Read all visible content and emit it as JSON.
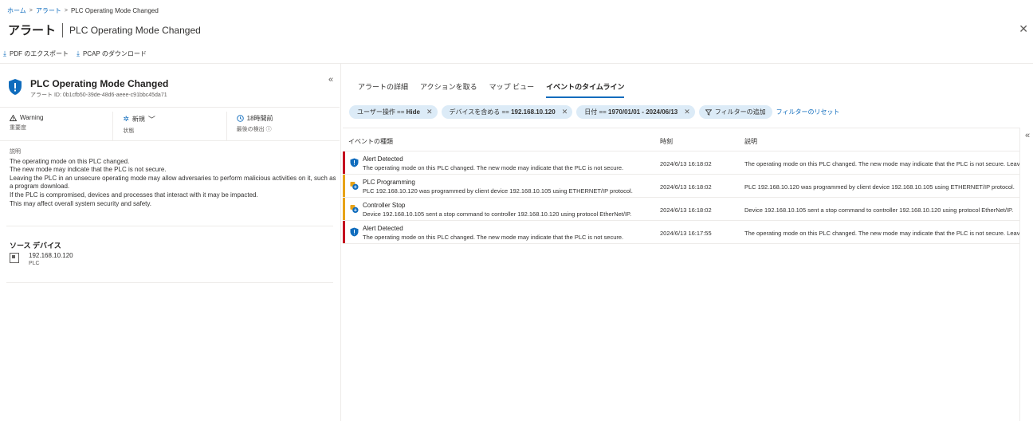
{
  "breadcrumb": {
    "home": "ホーム",
    "alerts": "アラート",
    "current": "PLC Operating Mode Changed"
  },
  "header": {
    "title": "アラート",
    "subtitle": "PLC Operating Mode Changed"
  },
  "toolbar": {
    "export_pdf": "PDF のエクスポート",
    "download_pcap": "PCAP のダウンロード"
  },
  "alert": {
    "name": "PLC Operating Mode Changed",
    "id": "アラート ID: 0b1cfb50-39de-48d6-aeee-c91bbc45da71",
    "severity_value": "Warning",
    "severity_label": "重要度",
    "status_value": "新規",
    "status_label": "状態",
    "last_detected_value": "18時間前",
    "last_detected_label": "最後の検出",
    "description_label": "説明",
    "description_lines": [
      "The operating mode on this PLC changed.",
      "The new mode may indicate that the PLC is not secure.",
      "Leaving the PLC in an unsecure operating mode may allow adversaries to perform malicious activities on it, such as a program download.",
      "If the PLC is compromised, devices and processes that interact with it may be impacted.",
      "This may affect overall system security and safety."
    ]
  },
  "source_device": {
    "title": "ソース デバイス",
    "ip": "192.168.10.120",
    "type": "PLC"
  },
  "tabs": [
    {
      "label": "アラートの詳細"
    },
    {
      "label": "アクションを取る"
    },
    {
      "label": "マップ ビュー"
    },
    {
      "label": "イベントのタイムライン"
    }
  ],
  "filters": [
    {
      "prefix": "ユーザー操作 == ",
      "value": "Hide"
    },
    {
      "prefix": "デバイスを含める == ",
      "value": "192.168.10.120"
    },
    {
      "prefix": "日付 == ",
      "value": "1970/01/01 - 2024/06/13"
    }
  ],
  "filter_add": "フィルターの追加",
  "filter_reset": "フィルターのリセット",
  "table": {
    "col_type": "イベントの種類",
    "col_time": "時刻",
    "col_desc": "説明",
    "rows": [
      {
        "title": "Alert Detected",
        "desc": "The operating mode on this PLC changed. The new mode may indicate that the PLC is not secure.",
        "time": "2024/6/13 16:18:02",
        "full": "The operating mode on this PLC changed. The new mode may indicate that the PLC is not secure. Leaving the PLC in an unsecure operating mode",
        "bar_color": "#c50f1f",
        "icon": "shield-icon"
      },
      {
        "title": "PLC Programming",
        "desc": "PLC 192.168.10.120 was programmed by client device 192.168.10.105 using ETHERNET/IP protocol.",
        "time": "2024/6/13 16:18:02",
        "full": "PLC 192.168.10.120 was programmed by client device 192.168.10.105 using ETHERNET/IP protocol.",
        "bar_color": "#e8a317",
        "icon": "device-event-icon"
      },
      {
        "title": "Controller Stop",
        "desc": "Device 192.168.10.105 sent a stop command to controller 192.168.10.120 using protocol EtherNet/IP.",
        "time": "2024/6/13 16:18:02",
        "full": "Device 192.168.10.105 sent a stop command to controller 192.168.10.120 using protocol EtherNet/IP.",
        "bar_color": "#e8a317",
        "icon": "device-event-icon"
      },
      {
        "title": "Alert Detected",
        "desc": "The operating mode on this PLC changed. The new mode may indicate that the PLC is not secure.",
        "time": "2024/6/13 16:17:55",
        "full": "The operating mode on this PLC changed. The new mode may indicate that the PLC is not secure. Leaving the PLC in an unsecure operating mode",
        "bar_color": "#c50f1f",
        "icon": "shield-icon"
      }
    ]
  },
  "colors": {
    "accent": "#0f6cbd",
    "high": "#c50f1f",
    "medium": "#e8a317",
    "pill_bg": "#dcebf7"
  }
}
